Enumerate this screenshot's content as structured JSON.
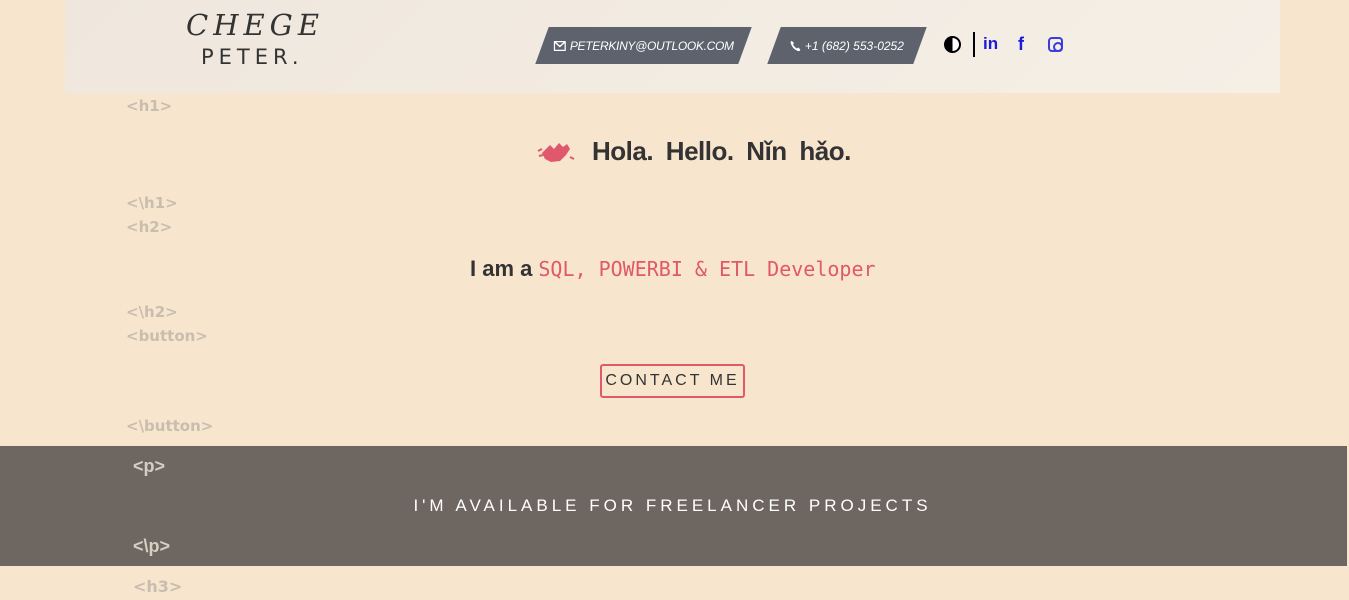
{
  "header": {
    "logo_line1": "CHEGE",
    "logo_line2": "PETER.",
    "email": "PETERKINY@OUTLOOK.COM",
    "phone": "+1 (682) 553-0252",
    "social": {
      "linkedin": "in",
      "facebook": "f"
    }
  },
  "tags": {
    "h1_open": "<h1>",
    "h1_close": "<\\h1>",
    "h2_open": "<h2>",
    "h2_close": "<\\h2>",
    "button_open": "<button>",
    "button_close": "<\\button>",
    "p_open": "<p>",
    "p_close": "<\\p>",
    "h3_open": "<h3>"
  },
  "hero": {
    "greeting": "Hola. Hello. Nǐn hǎo.",
    "role_prefix": "I am a",
    "role_value": "SQL, POWERBI & ETL Developer",
    "cta_label": "CONTACT ME"
  },
  "band": {
    "text": "I'M AVAILABLE FOR FREELANCER PROJECTS"
  },
  "colors": {
    "accent": "#e0586b",
    "background": "#f7e6cd",
    "band": "#6d6661",
    "pill": "#5d626d",
    "social": "#1a1adc"
  },
  "icons": {
    "email": "envelope-icon",
    "phone": "phone-icon",
    "theme": "contrast-icon",
    "wave": "waving-hand-icon"
  }
}
